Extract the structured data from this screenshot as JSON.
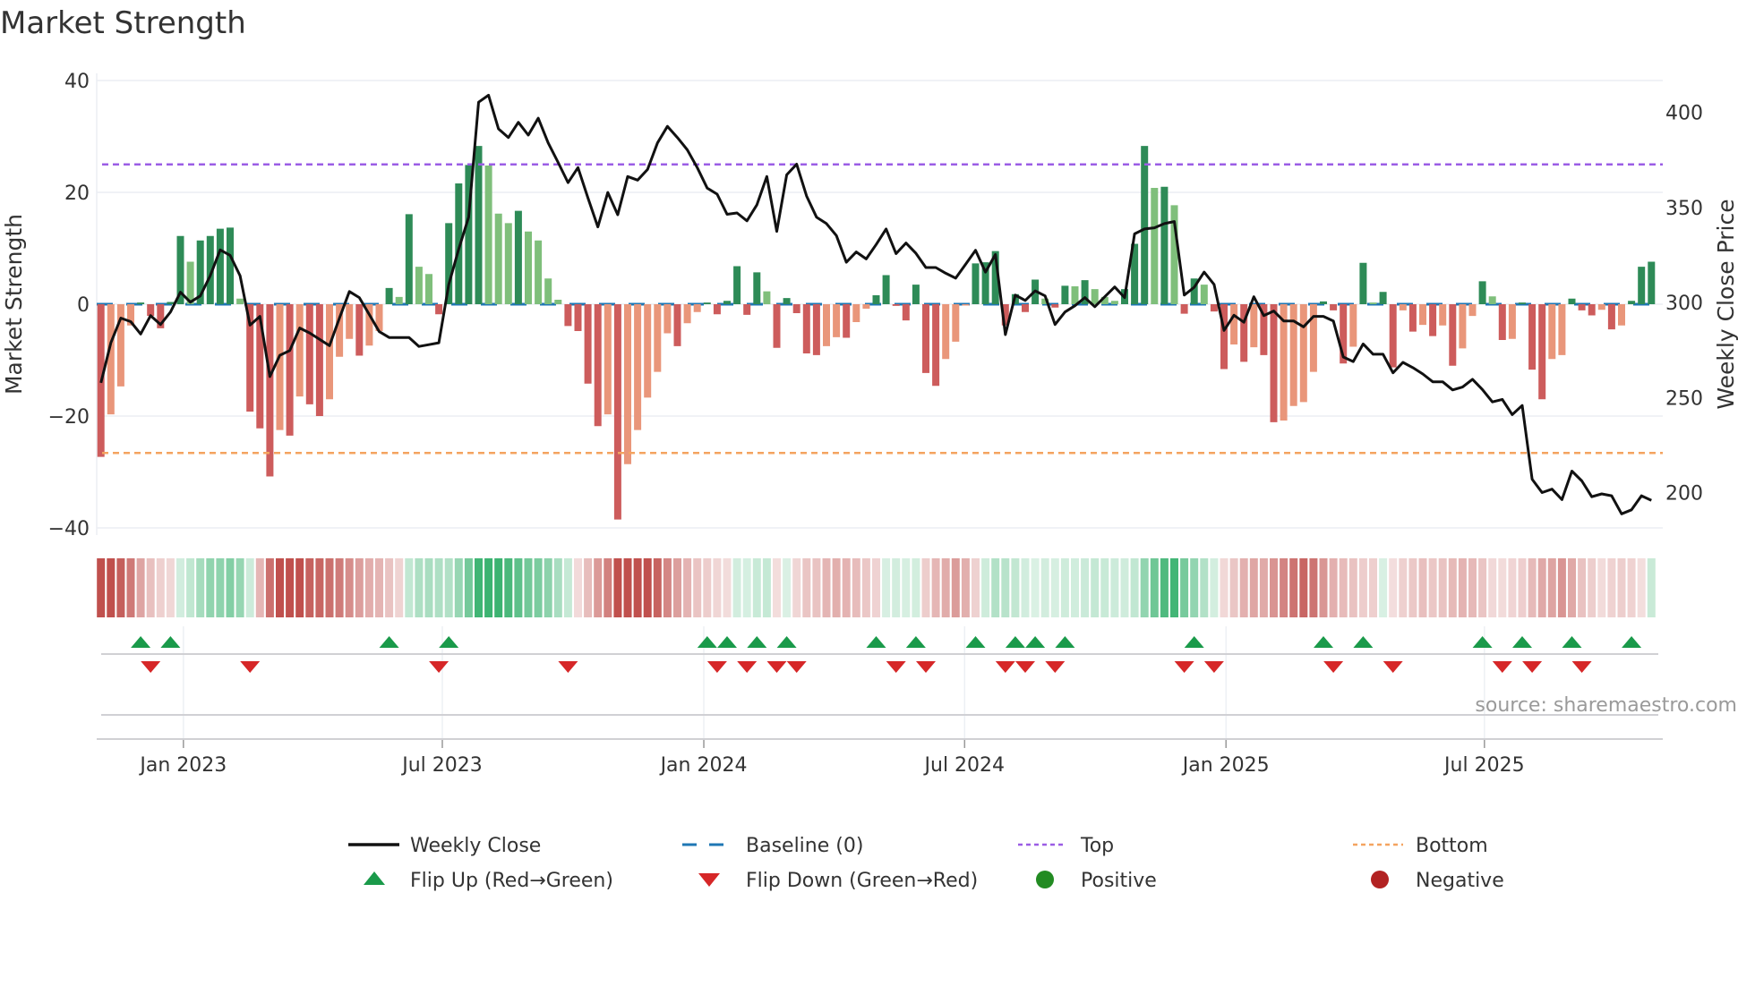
{
  "title": "Market Strength",
  "source": "source: sharemaestro.com",
  "colors": {
    "green_strong": "#2e8b57",
    "green_weak": "#7fbf7b",
    "red_strong": "#cd5c5c",
    "red_weak": "#e9967a",
    "close": "#111111",
    "baseline": "#1f77b4",
    "top": "#9b5de5",
    "bottom": "#f4a460",
    "flip_up": "#1a9a4a",
    "flip_down": "#d62728",
    "positive": "#228b22",
    "negative": "#b22222",
    "strip_green": "#3cb371",
    "strip_red": "#c0504d"
  },
  "chart_data": {
    "type": "bar+line",
    "title": "Market Strength",
    "ylabel": "Market Strength",
    "y2label": "Weekly Close Price",
    "ylim": [
      -40,
      40
    ],
    "y2lim": [
      181.4,
      416.8
    ],
    "yticks": [
      "40",
      "20",
      "0",
      "−20",
      "−40"
    ],
    "ytick_values": [
      40,
      20,
      0,
      -20,
      -40
    ],
    "y2ticks": [
      "400",
      "350",
      "300",
      "250",
      "200"
    ],
    "y2tick_values": [
      400,
      350,
      300,
      250,
      200
    ],
    "top_level": 25,
    "bottom_level": -26.6,
    "baseline": 0,
    "xticks": [
      {
        "label": "Jan 2023",
        "week": 8.3
      },
      {
        "label": "Jul 2023",
        "week": 34.35
      },
      {
        "label": "Jan 2024",
        "week": 60.66
      },
      {
        "label": "Jul 2024",
        "week": 86.9
      },
      {
        "label": "Jan 2025",
        "week": 113.2
      },
      {
        "label": "Jul 2025",
        "week": 139.2
      }
    ],
    "strength": [
      -27.3,
      -19.7,
      -14.7,
      -3.8,
      0.3,
      -2.1,
      -4.3,
      0.4,
      12.2,
      7.6,
      11.4,
      12.2,
      13.5,
      13.7,
      1.0,
      -19.2,
      -22.2,
      -30.8,
      -22.5,
      -23.5,
      -16.5,
      -17.9,
      -20,
      -17,
      -9.4,
      -6.2,
      -9.2,
      -7.4,
      -4.8,
      2.9,
      1.3,
      16.1,
      6.7,
      5.4,
      -1.8,
      14.5,
      21.6,
      24.9,
      28.3,
      24.8,
      16.2,
      14.5,
      16.7,
      13,
      11.4,
      4.6,
      0.8,
      -3.9,
      -4.8,
      -14.2,
      -21.8,
      -19.7,
      -38.5,
      -28.6,
      -22.5,
      -16.7,
      -12.1,
      -5.2,
      -7.5,
      -3.4,
      -1.4,
      0.3,
      -1.8,
      0.6,
      6.8,
      -1.9,
      5.7,
      2.3,
      -7.8,
      1.1,
      -1.6,
      -8.8,
      -9.1,
      -7.5,
      -5.9,
      -6,
      -3.2,
      -0.8,
      1.6,
      5.2,
      -0.3,
      -2.9,
      3.5,
      -12.3,
      -14.6,
      -9.8,
      -6.7,
      -0.2,
      7.3,
      7.5,
      9.5,
      -3.8,
      1.8,
      -1.4,
      4.4,
      1.0,
      -0.6,
      3.3,
      3.2,
      4.3,
      2.7,
      1.3,
      0.6,
      2.7,
      10.8,
      28.3,
      20.8,
      21,
      17.7,
      -1.7,
      4.6,
      3.5,
      -1.3,
      -11.6,
      -7.2,
      -10.3,
      -7.7,
      -9.1,
      -21.1,
      -20.8,
      -18.2,
      -17.5,
      -12.1,
      0.5,
      -1.1,
      -10.6,
      -7.6,
      7.4,
      0.3,
      2.2,
      -11.3,
      -1.1,
      -4.9,
      -3.7,
      -5.7,
      -3.8,
      -11,
      -7.9,
      -2.1,
      4.1,
      1.4,
      -6.4,
      -6.2,
      0.3,
      -11.7,
      -17,
      -9.8,
      -9.1,
      1.0,
      -1.1,
      -2.0,
      -1.0,
      -4.5,
      -3.8,
      0.6,
      6.7,
      7.6
    ],
    "close": [
      257.7,
      278.8,
      291.8,
      289.9,
      283.4,
      293.1,
      288.4,
      295,
      305.4,
      300.2,
      303.5,
      314.1,
      327.7,
      324.8,
      314.1,
      288.1,
      292.7,
      261,
      272.2,
      274.7,
      286.6,
      284,
      280.6,
      277.3,
      291.8,
      305.8,
      302.6,
      293.7,
      284.7,
      281.6,
      281.6,
      281.6,
      276.9,
      277.8,
      278.8,
      309.5,
      328.1,
      344.9,
      405.4,
      409.1,
      391.4,
      386.8,
      394.8,
      388.1,
      397,
      384,
      373.7,
      363.1,
      371,
      355.1,
      339.8,
      357.9,
      346.2,
      366.3,
      364.4,
      370,
      384,
      392.7,
      386.8,
      380.3,
      371,
      360.2,
      357,
      346.4,
      347.1,
      343,
      351.4,
      366.3,
      337.4,
      367.2,
      372.8,
      356,
      344.9,
      341.5,
      335.2,
      321.2,
      326.6,
      322.9,
      330.5,
      338.7,
      325.7,
      331.3,
      325.9,
      318.4,
      318.4,
      315.4,
      312.8,
      320.1,
      327.5,
      316,
      325.3,
      283.1,
      303.9,
      301.1,
      306.1,
      303.5,
      288.4,
      295,
      298.3,
      302.6,
      297.8,
      303,
      308.2,
      302.6,
      336.1,
      338.7,
      339.3,
      341.5,
      342.6,
      303.9,
      308,
      316,
      309.5,
      285.3,
      293.3,
      289.6,
      303,
      293.1,
      295.5,
      290.3,
      290.3,
      287.2,
      292.7,
      292.7,
      290.3,
      271.3,
      268.9,
      278.2,
      272.8,
      272.8,
      263,
      268.5,
      265.7,
      262.4,
      258.3,
      258.3,
      254,
      255.5,
      259.6,
      254.2,
      247.7,
      249,
      241,
      245.8,
      207,
      200,
      201.8,
      196.3,
      211.3,
      206.1,
      197.8,
      199.3,
      198.3,
      188.8,
      190.9,
      198.3,
      195.9
    ],
    "legend": {
      "placement": "bottom",
      "items": [
        "Weekly Close",
        "Baseline (0)",
        "Top",
        "Bottom",
        "Flip Up (Red→Green)",
        "Flip Down (Green→Red)",
        "Positive",
        "Negative"
      ]
    }
  }
}
